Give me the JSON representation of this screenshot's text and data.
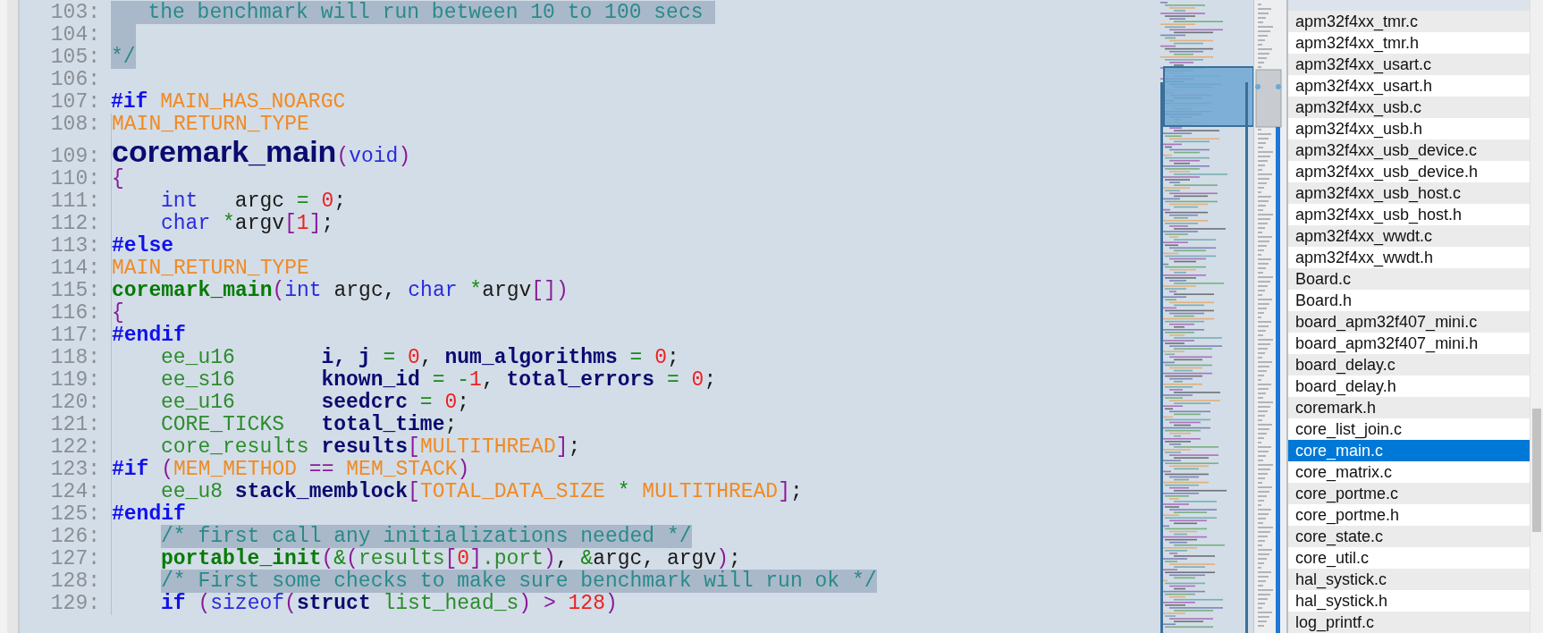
{
  "editor": {
    "lines": [
      {
        "number": "103:",
        "kind": "flush",
        "tokens": [
          {
            "text": "   the benchmark will run between 10 to 100 secs ",
            "kind": "comment",
            "marked": true
          }
        ]
      },
      {
        "number": "104:",
        "blank_selected": true
      },
      {
        "number": "105:",
        "kind": "flush",
        "tokens": [
          {
            "text": "*/",
            "kind": "comment",
            "marked": true
          }
        ]
      },
      {
        "number": "106:"
      },
      {
        "number": "107:",
        "kind": "flush",
        "tokens": [
          {
            "text": "#if ",
            "kind": "preproc",
            "marked": false
          },
          {
            "text": "MAIN_HAS_NOARGC",
            "kind": "macro",
            "marked": false
          }
        ]
      },
      {
        "number": "108:",
        "kind": "flush",
        "tokens": [
          {
            "text": "MAIN_RETURN_TYPE",
            "kind": "macro",
            "marked": false
          }
        ]
      },
      {
        "number": "109:",
        "kind": "flush",
        "tokens": [
          {
            "text": "coremark_main",
            "kind": "title",
            "marked": false
          },
          {
            "text": "(",
            "kind": "punct",
            "marked": false
          },
          {
            "text": "void",
            "kind": "keyword",
            "marked": false
          },
          {
            "text": ")",
            "kind": "punct",
            "marked": false
          }
        ]
      },
      {
        "number": "110:",
        "kind": "flush",
        "tokens": [
          {
            "text": "{",
            "kind": "punct",
            "marked": false
          }
        ]
      },
      {
        "number": "111:",
        "kind": "indented",
        "tokens": [
          {
            "text": "int",
            "kind": "keyword",
            "marked": false
          },
          {
            "text": "   argc ",
            "kind": "plain",
            "marked": false
          },
          {
            "text": "= ",
            "kind": "op",
            "marked": false
          },
          {
            "text": "0",
            "kind": "number",
            "marked": false
          },
          {
            "text": ";",
            "kind": "plain",
            "marked": false
          }
        ]
      },
      {
        "number": "112:",
        "kind": "indented",
        "tokens": [
          {
            "text": "char ",
            "kind": "keyword",
            "marked": false
          },
          {
            "text": "*",
            "kind": "op",
            "marked": false
          },
          {
            "text": "argv",
            "kind": "plain",
            "marked": false
          },
          {
            "text": "[",
            "kind": "punct",
            "marked": false
          },
          {
            "text": "1",
            "kind": "number",
            "marked": false
          },
          {
            "text": "]",
            "kind": "punct",
            "marked": false
          },
          {
            "text": ";",
            "kind": "plain",
            "marked": false
          }
        ]
      },
      {
        "number": "113:",
        "kind": "flush",
        "tokens": [
          {
            "text": "#else",
            "kind": "preproc",
            "marked": false
          }
        ]
      },
      {
        "number": "114:",
        "kind": "flush",
        "tokens": [
          {
            "text": "MAIN_RETURN_TYPE",
            "kind": "macro",
            "marked": false
          }
        ]
      },
      {
        "number": "115:",
        "kind": "flush",
        "tokens": [
          {
            "text": "coremark_main",
            "kind": "call",
            "marked": false
          },
          {
            "text": "(",
            "kind": "punct",
            "marked": false
          },
          {
            "text": "int",
            "kind": "keyword",
            "marked": false
          },
          {
            "text": " argc, ",
            "kind": "plain",
            "marked": false
          },
          {
            "text": "char ",
            "kind": "keyword",
            "marked": false
          },
          {
            "text": "*",
            "kind": "op",
            "marked": false
          },
          {
            "text": "argv",
            "kind": "plain",
            "marked": false
          },
          {
            "text": "[])",
            "kind": "punct",
            "marked": false
          }
        ]
      },
      {
        "number": "116:",
        "kind": "flush",
        "tokens": [
          {
            "text": "{",
            "kind": "punct",
            "marked": false
          }
        ]
      },
      {
        "number": "117:",
        "kind": "flush",
        "tokens": [
          {
            "text": "#endif",
            "kind": "preproc",
            "marked": false
          }
        ]
      },
      {
        "number": "118:",
        "kind": "indented",
        "tokens": [
          {
            "text": "ee_u16       ",
            "kind": "type",
            "marked": false
          },
          {
            "text": "i, j ",
            "kind": "decl",
            "marked": false
          },
          {
            "text": "= ",
            "kind": "op",
            "marked": false
          },
          {
            "text": "0",
            "kind": "number",
            "marked": false
          },
          {
            "text": ", ",
            "kind": "plain",
            "marked": false
          },
          {
            "text": "num_algorithms ",
            "kind": "decl",
            "marked": false
          },
          {
            "text": "= ",
            "kind": "op",
            "marked": false
          },
          {
            "text": "0",
            "kind": "number",
            "marked": false
          },
          {
            "text": ";",
            "kind": "plain",
            "marked": false
          }
        ]
      },
      {
        "number": "119:",
        "kind": "indented",
        "tokens": [
          {
            "text": "ee_s16       ",
            "kind": "type",
            "marked": false
          },
          {
            "text": "known_id ",
            "kind": "decl",
            "marked": false
          },
          {
            "text": "= -",
            "kind": "op",
            "marked": false
          },
          {
            "text": "1",
            "kind": "number",
            "marked": false
          },
          {
            "text": ", ",
            "kind": "plain",
            "marked": false
          },
          {
            "text": "total_errors ",
            "kind": "decl",
            "marked": false
          },
          {
            "text": "= ",
            "kind": "op",
            "marked": false
          },
          {
            "text": "0",
            "kind": "number",
            "marked": false
          },
          {
            "text": ";",
            "kind": "plain",
            "marked": false
          }
        ]
      },
      {
        "number": "120:",
        "kind": "indented",
        "tokens": [
          {
            "text": "ee_u16       ",
            "kind": "type",
            "marked": false
          },
          {
            "text": "seedcrc ",
            "kind": "decl",
            "marked": false
          },
          {
            "text": "= ",
            "kind": "op",
            "marked": false
          },
          {
            "text": "0",
            "kind": "number",
            "marked": false
          },
          {
            "text": ";",
            "kind": "plain",
            "marked": false
          }
        ]
      },
      {
        "number": "121:",
        "kind": "indented",
        "tokens": [
          {
            "text": "CORE_TICKS   ",
            "kind": "type",
            "marked": false
          },
          {
            "text": "total_time",
            "kind": "decl",
            "marked": false
          },
          {
            "text": ";",
            "kind": "plain",
            "marked": false
          }
        ]
      },
      {
        "number": "122:",
        "kind": "indented",
        "tokens": [
          {
            "text": "core_results ",
            "kind": "type",
            "marked": false
          },
          {
            "text": "results",
            "kind": "decl",
            "marked": false
          },
          {
            "text": "[",
            "kind": "punct",
            "marked": false
          },
          {
            "text": "MULTITHREAD",
            "kind": "macro",
            "marked": false
          },
          {
            "text": "]",
            "kind": "punct",
            "marked": false
          },
          {
            "text": ";",
            "kind": "plain",
            "marked": false
          }
        ]
      },
      {
        "number": "123:",
        "kind": "flush",
        "tokens": [
          {
            "text": "#if ",
            "kind": "preproc",
            "marked": false
          },
          {
            "text": "(",
            "kind": "punct",
            "marked": false
          },
          {
            "text": "MEM_METHOD ",
            "kind": "macro",
            "marked": false
          },
          {
            "text": "== ",
            "kind": "punct",
            "marked": false
          },
          {
            "text": "MEM_STACK",
            "kind": "macro",
            "marked": false
          },
          {
            "text": ")",
            "kind": "punct",
            "marked": false
          }
        ]
      },
      {
        "number": "124:",
        "kind": "indented",
        "tokens": [
          {
            "text": "ee_u8 ",
            "kind": "type",
            "marked": false
          },
          {
            "text": "stack_memblock",
            "kind": "decl",
            "marked": false
          },
          {
            "text": "[",
            "kind": "punct",
            "marked": false
          },
          {
            "text": "TOTAL_DATA_SIZE ",
            "kind": "macro",
            "marked": false
          },
          {
            "text": "* ",
            "kind": "op",
            "marked": false
          },
          {
            "text": "MULTITHREAD",
            "kind": "macro",
            "marked": false
          },
          {
            "text": "]",
            "kind": "punct",
            "marked": false
          },
          {
            "text": ";",
            "kind": "plain",
            "marked": false
          }
        ]
      },
      {
        "number": "125:",
        "kind": "flush",
        "tokens": [
          {
            "text": "#endif",
            "kind": "preproc",
            "marked": false
          }
        ]
      },
      {
        "number": "126:",
        "kind": "indented",
        "tokens": [
          {
            "text": "/* first call any initializations needed */",
            "kind": "comment",
            "marked": true
          }
        ]
      },
      {
        "number": "127:",
        "kind": "indented",
        "tokens": [
          {
            "text": "portable_init",
            "kind": "call",
            "marked": false
          },
          {
            "text": "(",
            "kind": "punct",
            "marked": false
          },
          {
            "text": "&",
            "kind": "op",
            "marked": false
          },
          {
            "text": "(",
            "kind": "punct",
            "marked": false
          },
          {
            "text": "results",
            "kind": "type",
            "marked": false
          },
          {
            "text": "[",
            "kind": "punct",
            "marked": false
          },
          {
            "text": "0",
            "kind": "number",
            "marked": false
          },
          {
            "text": "]",
            "kind": "punct",
            "marked": false
          },
          {
            "text": ".port",
            "kind": "type",
            "marked": false
          },
          {
            "text": ")",
            "kind": "punct",
            "marked": false
          },
          {
            "text": ", ",
            "kind": "plain",
            "marked": false
          },
          {
            "text": "&",
            "kind": "op",
            "marked": false
          },
          {
            "text": "argc, argv",
            "kind": "plain",
            "marked": false
          },
          {
            "text": ")",
            "kind": "punct",
            "marked": false
          },
          {
            "text": ";",
            "kind": "plain",
            "marked": false
          }
        ]
      },
      {
        "number": "128:",
        "kind": "indented",
        "tokens": [
          {
            "text": "/* First some checks to make sure benchmark will run ok */",
            "kind": "comment",
            "marked": true
          }
        ]
      },
      {
        "number": "129:",
        "kind": "indented",
        "tokens": [
          {
            "text": "if ",
            "kind": "preproc",
            "marked": false
          },
          {
            "text": "(",
            "kind": "punct",
            "marked": false
          },
          {
            "text": "sizeof",
            "kind": "keyword",
            "marked": false
          },
          {
            "text": "(",
            "kind": "punct",
            "marked": false
          },
          {
            "text": "struct ",
            "kind": "decl",
            "marked": false
          },
          {
            "text": "list_head_s",
            "kind": "type",
            "marked": false
          },
          {
            "text": ") > ",
            "kind": "punct",
            "marked": false
          },
          {
            "text": "128",
            "kind": "number",
            "marked": false
          },
          {
            "text": ")",
            "kind": "punct",
            "marked": false
          }
        ]
      }
    ]
  },
  "file_list": {
    "files": [
      {
        "name": "apm32f4xx_tmr.c",
        "selected": false
      },
      {
        "name": "apm32f4xx_tmr.h",
        "selected": false
      },
      {
        "name": "apm32f4xx_usart.c",
        "selected": false
      },
      {
        "name": "apm32f4xx_usart.h",
        "selected": false
      },
      {
        "name": "apm32f4xx_usb.c",
        "selected": false
      },
      {
        "name": "apm32f4xx_usb.h",
        "selected": false
      },
      {
        "name": "apm32f4xx_usb_device.c",
        "selected": false
      },
      {
        "name": "apm32f4xx_usb_device.h",
        "selected": false
      },
      {
        "name": "apm32f4xx_usb_host.c",
        "selected": false
      },
      {
        "name": "apm32f4xx_usb_host.h",
        "selected": false
      },
      {
        "name": "apm32f4xx_wwdt.c",
        "selected": false
      },
      {
        "name": "apm32f4xx_wwdt.h",
        "selected": false
      },
      {
        "name": "Board.c",
        "selected": false
      },
      {
        "name": "Board.h",
        "selected": false
      },
      {
        "name": "board_apm32f407_mini.c",
        "selected": false
      },
      {
        "name": "board_apm32f407_mini.h",
        "selected": false
      },
      {
        "name": "board_delay.c",
        "selected": false
      },
      {
        "name": "board_delay.h",
        "selected": false
      },
      {
        "name": "coremark.h",
        "selected": false
      },
      {
        "name": "core_list_join.c",
        "selected": false
      },
      {
        "name": "core_main.c",
        "selected": true
      },
      {
        "name": "core_matrix.c",
        "selected": false
      },
      {
        "name": "core_portme.c",
        "selected": false
      },
      {
        "name": "core_portme.h",
        "selected": false
      },
      {
        "name": "core_state.c",
        "selected": false
      },
      {
        "name": "core_util.c",
        "selected": false
      },
      {
        "name": "hal_systick.c",
        "selected": false
      },
      {
        "name": "hal_systick.h",
        "selected": false
      },
      {
        "name": "log_printf.c",
        "selected": false
      }
    ]
  }
}
